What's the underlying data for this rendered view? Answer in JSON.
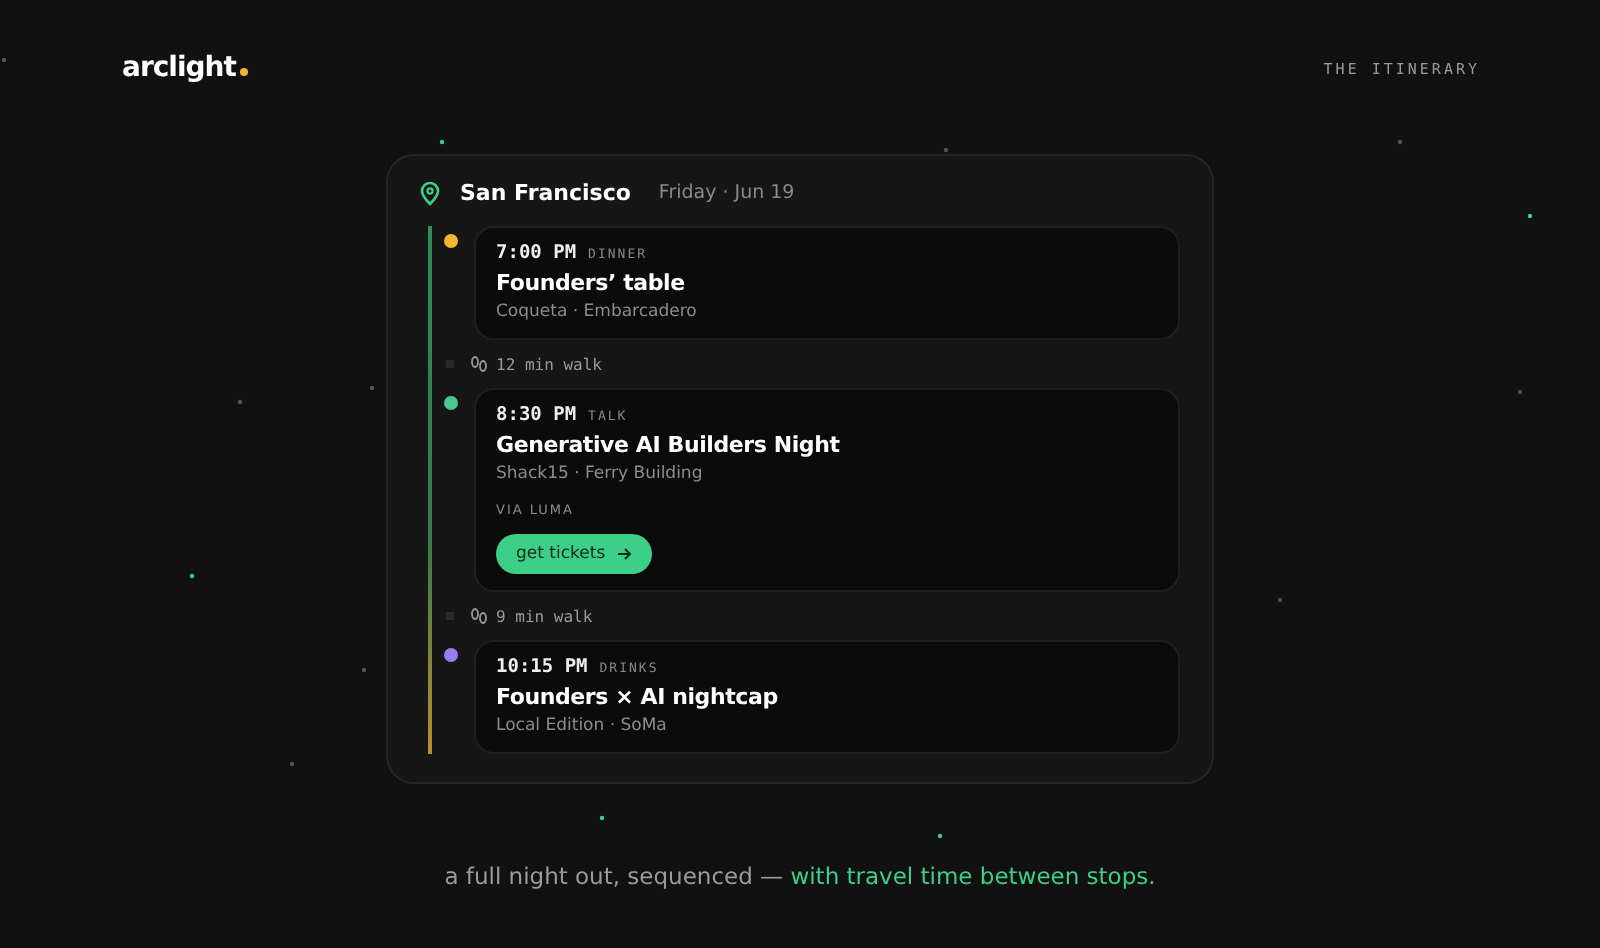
{
  "brand": {
    "name": "arclight"
  },
  "nav_label": "THE ITINERARY",
  "itinerary": {
    "city": "San Francisco",
    "date": "Friday · Jun 19",
    "items": [
      {
        "kind": "event",
        "time": "7:00 PM",
        "category": "DINNER",
        "title": "Founders’ table",
        "venue": "Coqueta · Embarcadero",
        "color": "#f5b731"
      },
      {
        "kind": "walk",
        "text": "12 min walk"
      },
      {
        "kind": "event",
        "time": "8:30 PM",
        "category": "TALK",
        "title": "Generative AI Builders Night",
        "venue": "Shack15 · Ferry Building",
        "source": "VIA LUMA",
        "action": "get tickets",
        "color": "#4cc98f"
      },
      {
        "kind": "walk",
        "text": "9 min walk"
      },
      {
        "kind": "event",
        "time": "10:15 PM",
        "category": "DRINKS",
        "title": "Founders × AI nightcap",
        "venue": "Local Edition · SoMa",
        "color": "#9a7cf0"
      }
    ]
  },
  "tagline": {
    "text": "a full night out, sequenced — ",
    "highlight": "with travel time between stops."
  }
}
